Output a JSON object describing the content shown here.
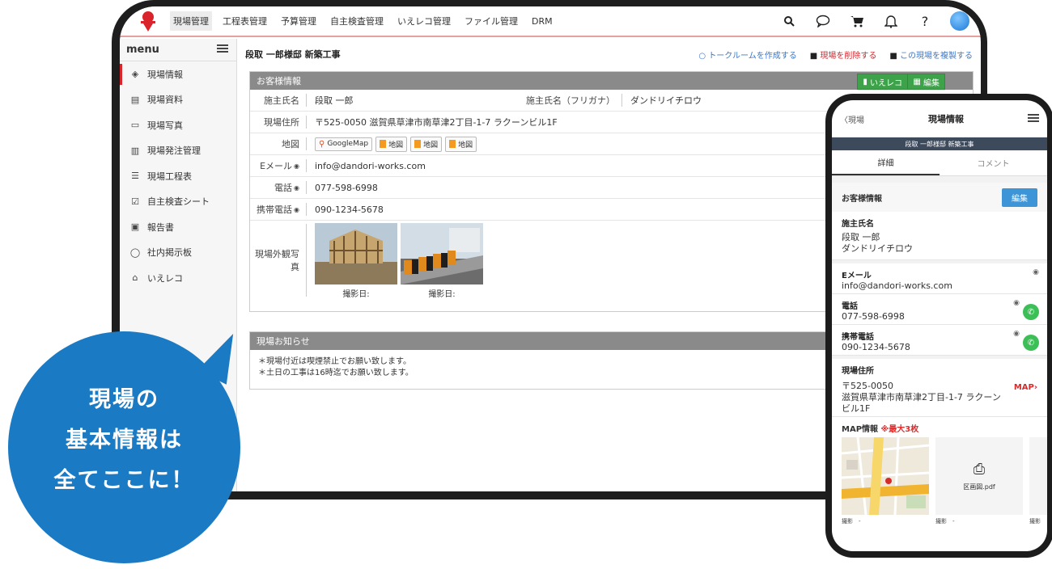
{
  "nav": {
    "items": [
      "現場管理",
      "工程表管理",
      "予算管理",
      "自主検査管理",
      "いえレコ管理",
      "ファイル管理",
      "DRM"
    ],
    "icons": [
      "search-icon",
      "chat-icon",
      "cart-icon",
      "bell-icon",
      "help-icon",
      "avatar"
    ]
  },
  "sidebar": {
    "title": "menu",
    "items": [
      {
        "label": "現場情報",
        "icon": "cube-icon"
      },
      {
        "label": "現場資料",
        "icon": "document-icon"
      },
      {
        "label": "現場写真",
        "icon": "photo-icon"
      },
      {
        "label": "現場発注管理",
        "icon": "order-icon"
      },
      {
        "label": "現場工程表",
        "icon": "gantt-icon"
      },
      {
        "label": "自主検査シート",
        "icon": "check-icon"
      },
      {
        "label": "報告書",
        "icon": "report-icon"
      },
      {
        "label": "社内掲示板",
        "icon": "chat-icon"
      },
      {
        "label": "いえレコ",
        "icon": "house-icon"
      }
    ]
  },
  "main": {
    "title": "段取 一郎様邸 新築工事",
    "actions": {
      "talk": "トークルームを作成する",
      "delete": "現場を削除する",
      "copy": "この現場を複製する"
    },
    "customer": {
      "header": "お客様情報",
      "iereco_btn": "いえレコ",
      "edit_btn": "編集",
      "name_label": "施主氏名",
      "name": "段取 一郎",
      "kana_label": "施主氏名（フリガナ）",
      "kana": "ダンドリイチロウ",
      "address_label": "現場住所",
      "address": "〒525-0050 滋賀県草津市南草津2丁目-1-7 ラクーンビル1F",
      "map_label": "地図",
      "map_buttons": [
        "GoogleMap",
        "地図",
        "地図",
        "地図"
      ],
      "email_label": "Eメール",
      "email": "info@dandori-works.com",
      "phone_label": "電話",
      "phone": "077-598-6998",
      "mobile_label": "携帯電話",
      "mobile": "090-1234-5678",
      "photos_label": "現場外観写真",
      "photo_captions": [
        "撮影日:",
        "撮影日:"
      ]
    },
    "notice": {
      "header": "現場お知らせ",
      "lines": [
        "＊現場付近は喫煙禁止でお願い致します。",
        "＊土日の工事は16時迄でお願い致します。"
      ]
    }
  },
  "bubble": {
    "line1": "現場の",
    "line2": "基本情報は",
    "line3": "全てここに！"
  },
  "phone": {
    "back": "現場",
    "title": "現場情報",
    "subtitle": "段取 一郎様邸 新築工事",
    "tabs": [
      "詳細",
      "コメント"
    ],
    "section": "お客様情報",
    "edit": "編集",
    "name_label": "施主氏名",
    "name": "段取 一郎",
    "kana": "ダンドリイチロウ",
    "email_label": "Eメール",
    "email": "info@dandori-works.com",
    "phone_label": "電話",
    "phone": "077-598-6998",
    "mobile_label": "携帯電話",
    "mobile": "090-1234-5678",
    "address_label": "現場住所",
    "zip": "〒525-0050",
    "address": "滋賀県草津市南草津2丁目-1-7 ラクーンビル1F",
    "map_link": "MAP",
    "mapinfo_label": "MAP情報",
    "mapinfo_note": "※最大3枚",
    "pdf_name": "区画図.pdf",
    "thumb_caps": [
      "撮影　-",
      "撮影　-",
      "撮影"
    ]
  },
  "colors": {
    "accent_red": "#d9242b",
    "green": "#3ea24a",
    "blue": "#1a7ac4",
    "panel_gray": "#8a8a8a"
  }
}
